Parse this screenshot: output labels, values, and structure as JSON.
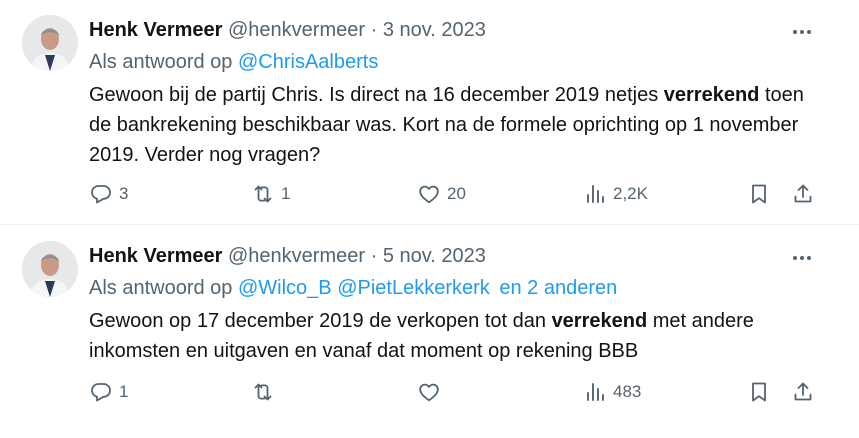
{
  "tweets": [
    {
      "name": "Henk Vermeer",
      "handle": "@henkvermeer",
      "separator": "·",
      "date": "3 nov. 2023",
      "reply_prefix": "Als antwoord op",
      "reply_mentions": [
        "@ChrisAalberts"
      ],
      "reply_suffix": "",
      "text": {
        "p1": "Gewoon bij de partij Chris. Is direct na 16 december 2019 netjes ",
        "bold": "verrekend",
        "p2": " toen de bankrekening beschikbaar was. Kort na de formele oprichting op 1 november 2019. Verder nog vragen?"
      },
      "stats": {
        "replies": "3",
        "retweets": "1",
        "likes": "20",
        "views": "2,2K"
      }
    },
    {
      "name": "Henk Vermeer",
      "handle": "@henkvermeer",
      "separator": "·",
      "date": "5 nov. 2023",
      "reply_prefix": "Als antwoord op",
      "reply_mentions": [
        "@Wilco_B",
        "@PietLekkerkerk"
      ],
      "reply_suffix": "en 2 anderen",
      "text": {
        "p1": "Gewoon op 17 december 2019 de verkopen tot dan ",
        "bold": "verrekend",
        "p2": " met andere inkomsten en uitgaven en vanaf dat moment op rekening BBB"
      },
      "stats": {
        "replies": "1",
        "retweets": "",
        "likes": "",
        "views": "483"
      }
    }
  ],
  "colors": {
    "text": "#0f1419",
    "secondary": "#536471",
    "link": "#1d9bf0",
    "divider": "#eff3f4"
  },
  "icons": [
    "more-icon",
    "reply-icon",
    "retweet-icon",
    "like-icon",
    "views-icon",
    "bookmark-icon",
    "share-icon"
  ]
}
